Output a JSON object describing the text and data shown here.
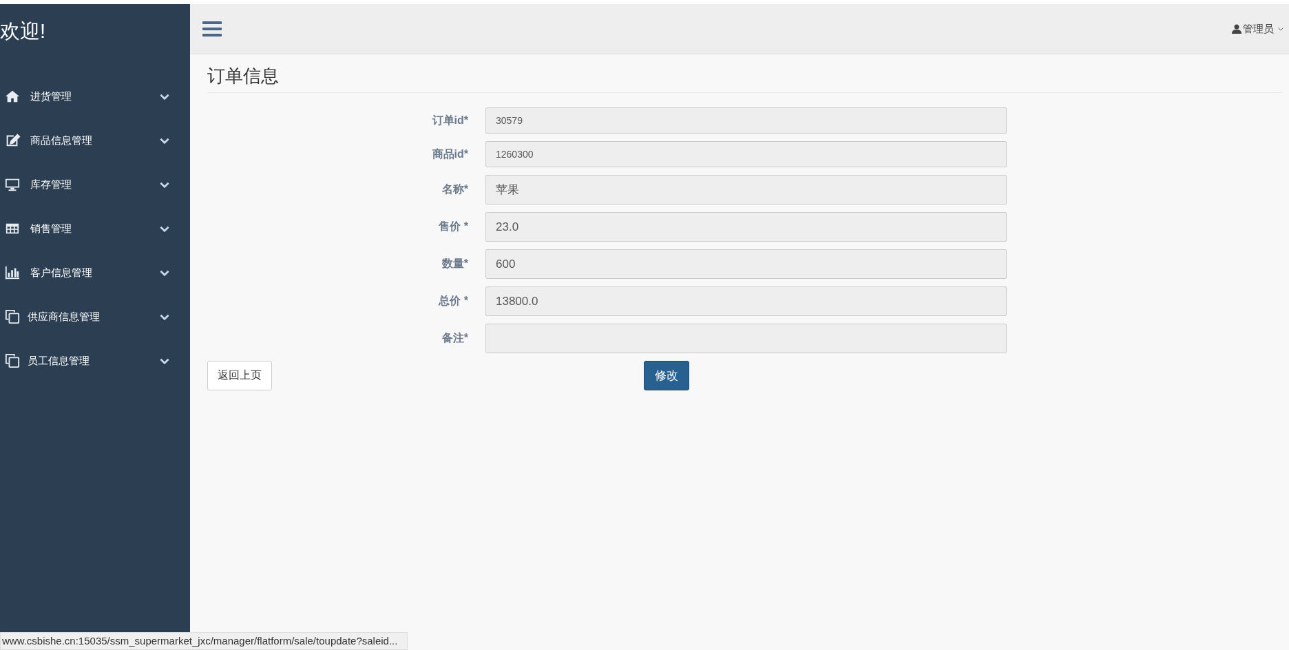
{
  "sidebar": {
    "title": "欢迎!",
    "items": [
      {
        "label": "进货管理",
        "expanded": false
      },
      {
        "label": "商品信息管理",
        "expanded": false
      },
      {
        "label": "库存管理",
        "expanded": false
      },
      {
        "label": "销售管理",
        "expanded": false
      },
      {
        "label": "客户信息管理",
        "expanded": false
      },
      {
        "label": "供应商信息管理",
        "expanded": false
      },
      {
        "label": "员工信息管理",
        "expanded": false
      }
    ]
  },
  "topbar": {
    "user": "管理员"
  },
  "page": {
    "title": "订单信息"
  },
  "form": {
    "fields": [
      {
        "label": "订单id*",
        "value": "30579"
      },
      {
        "label": "商品id*",
        "value": "1260300"
      },
      {
        "label": "名称*",
        "value": "苹果"
      },
      {
        "label": "售价 *",
        "value": "23.0"
      },
      {
        "label": "数量*",
        "value": "600"
      },
      {
        "label": "总价 *",
        "value": "13800.0"
      },
      {
        "label": "备注*"
      }
    ],
    "back_button": "返回上页",
    "submit_button": "修改"
  },
  "status_bar": {
    "url": "www.csbishe.cn:15035/ssm_supermarket_jxc/manager/flatform/sale/toupdate?saleid..."
  }
}
